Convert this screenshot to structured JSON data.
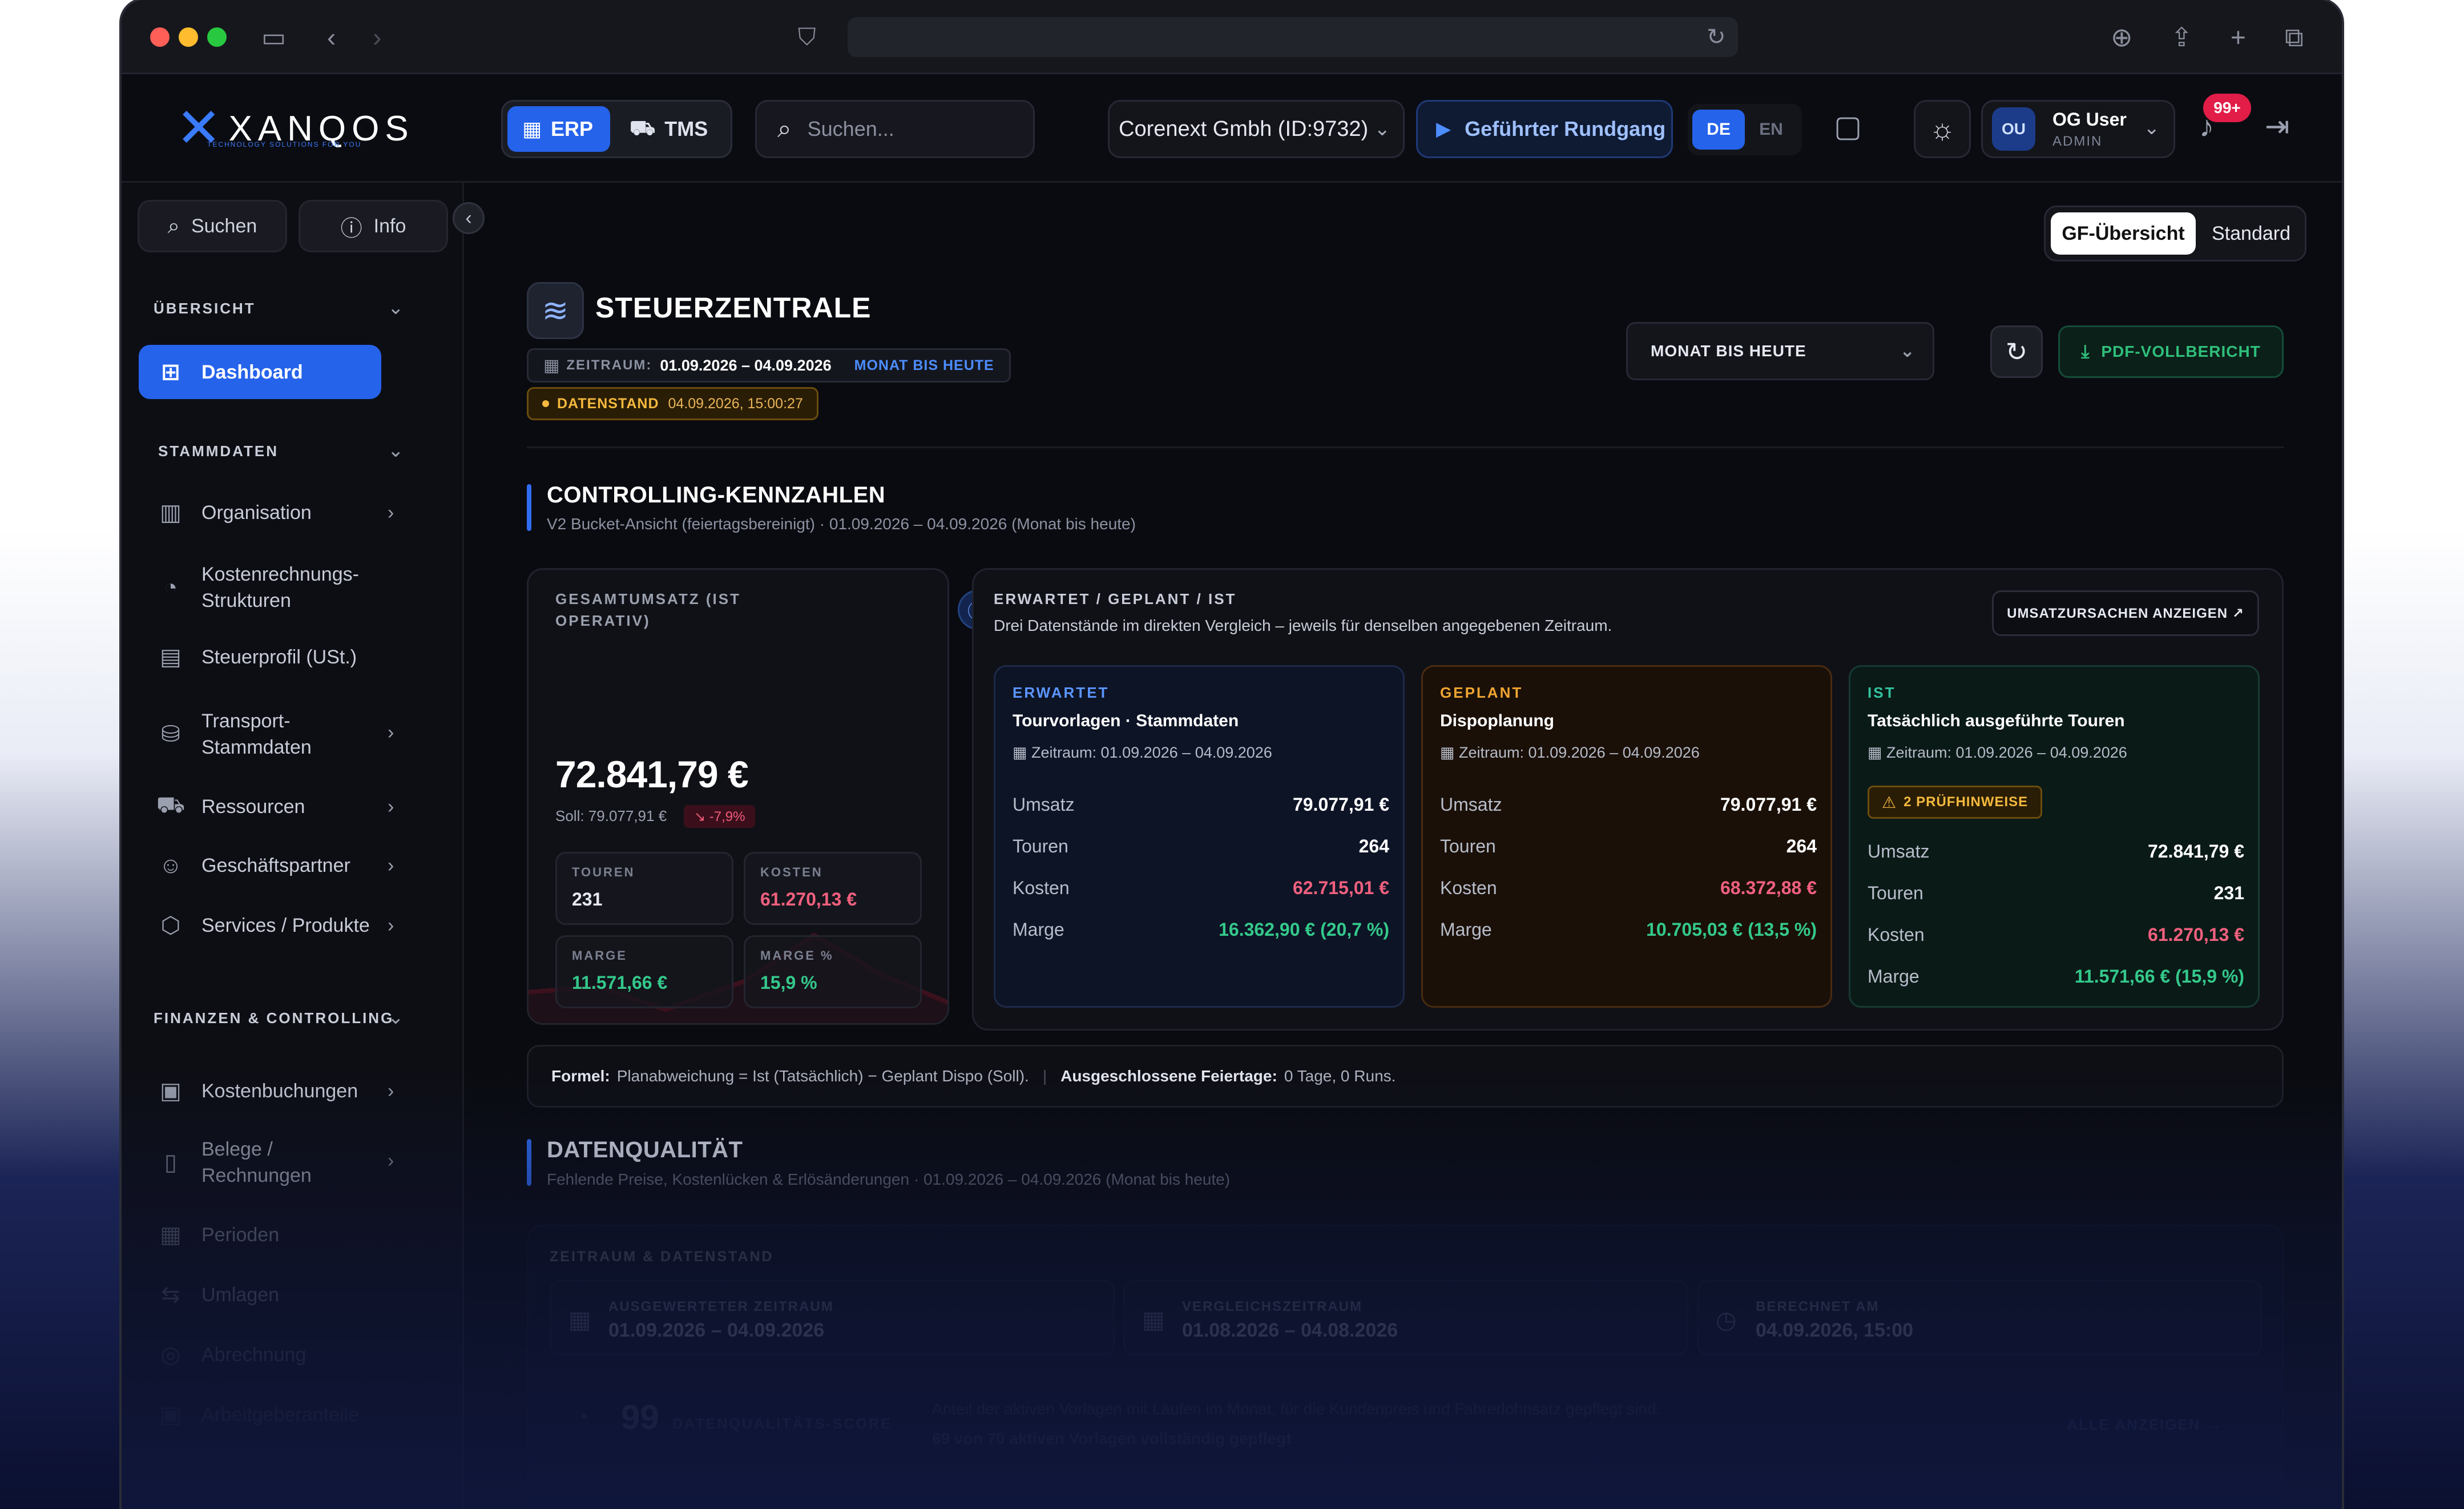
{
  "header": {
    "logo_text": "XANQOS",
    "logo_sub": "TECHNOLOGY SOLUTIONS FOR YOU",
    "systems": [
      {
        "label": "ERP",
        "active": true
      },
      {
        "label": "TMS",
        "active": false
      }
    ],
    "search_placeholder": "Suchen...",
    "company": "Corenext Gmbh (ID:9732)",
    "guided_tour": "Geführter Rundgang",
    "languages": [
      {
        "label": "DE",
        "active": true
      },
      {
        "label": "EN",
        "active": false
      }
    ],
    "user": {
      "initials": "OU",
      "name": "OG User",
      "role": "ADMIN"
    },
    "notifications": "99+"
  },
  "sidebar": {
    "search_label": "Suchen",
    "info_label": "Info",
    "sections": [
      {
        "title": "ÜBERSICHT"
      },
      {
        "title": "STAMMDATEN"
      },
      {
        "title": "FINANZEN & CONTROLLING"
      }
    ],
    "items": {
      "dashboard": "Dashboard",
      "organisation": "Organisation",
      "kostenrechnung": "Kostenrechnungs-\nStrukturen",
      "steuerprofil": "Steuerprofil (USt.)",
      "transport": "Transport-\nStammdaten",
      "ressourcen": "Ressourcen",
      "geschaeftspartner": "Geschäftspartner",
      "services": "Services / Produkte",
      "kostenbuchungen": "Kostenbuchungen",
      "belege": "Belege /\nRechnungen",
      "perioden": "Perioden",
      "umlagen": "Umlagen",
      "abrechnung": "Abrechnung",
      "arbeitgeber": "Arbeitgeberanteile"
    }
  },
  "view_toggle": [
    {
      "label": "GF-Übersicht",
      "active": true
    },
    {
      "label": "Standard",
      "active": false
    }
  ],
  "page": {
    "title": "STEUERZENTRALE",
    "zeitraum_key": "ZEITRAUM:",
    "zeitraum_value": "01.09.2026 – 04.09.2026",
    "zeitraum_tag": "MONAT BIS HEUTE",
    "datenstand_key": "DATENSTAND",
    "datenstand_value": "04.09.2026, 15:00:27",
    "range_select": "MONAT BIS HEUTE",
    "pdf_button": "PDF-VOLLBERICHT"
  },
  "controlling": {
    "title": "CONTROLLING-KENNZAHLEN",
    "subtitle": "V2 Bucket-Ansicht (feiertagsbereinigt) · 01.09.2026 – 04.09.2026 (Monat bis heute)",
    "gesamtumsatz_label": "GESAMTUMSATZ (IST OPERATIV)",
    "gesamtumsatz_value": "72.841,79 €",
    "soll": "Soll: 79.077,91 €",
    "delta": "↘ -7,9%",
    "minis": [
      {
        "key": "TOUREN",
        "value": "231",
        "tone": "white"
      },
      {
        "key": "KOSTEN",
        "value": "61.270,13 €",
        "tone": "red"
      },
      {
        "key": "MARGE",
        "value": "11.571,66 €",
        "tone": "green"
      },
      {
        "key": "MARGE %",
        "value": "15,9 %",
        "tone": "green"
      }
    ],
    "compare_label": "ERWARTET / GEPLANT / IST",
    "compare_desc": "Drei Datenstände im direkten Vergleich – jeweils für denselben angegebenen Zeitraum.",
    "reason_button": "UMSATZURSACHEN ANZEIGEN ↗",
    "columns": [
      {
        "title": "ERWARTET",
        "subtitle": "Tourvorlagen · Stammdaten",
        "period": "Zeitraum: 01.09.2026 – 04.09.2026",
        "rows": [
          {
            "k": "Umsatz",
            "v": "79.077,91 €"
          },
          {
            "k": "Touren",
            "v": "264"
          },
          {
            "k": "Kosten",
            "v": "62.715,01 €"
          },
          {
            "k": "Marge",
            "v": "16.362,90 € (20,7 %)"
          }
        ]
      },
      {
        "title": "GEPLANT",
        "subtitle": "Dispoplanung",
        "period": "Zeitraum: 01.09.2026 – 04.09.2026",
        "rows": [
          {
            "k": "Umsatz",
            "v": "79.077,91 €"
          },
          {
            "k": "Touren",
            "v": "264"
          },
          {
            "k": "Kosten",
            "v": "68.372,88 €"
          },
          {
            "k": "Marge",
            "v": "10.705,03 € (13,5 %)"
          }
        ]
      },
      {
        "title": "IST",
        "subtitle": "Tatsächlich ausgeführte Touren",
        "period": "Zeitraum: 01.09.2026 – 04.09.2026",
        "warning": "2 PRÜFHINWEISE",
        "rows": [
          {
            "k": "Umsatz",
            "v": "72.841,79 €"
          },
          {
            "k": "Touren",
            "v": "231"
          },
          {
            "k": "Kosten",
            "v": "61.270,13 €"
          },
          {
            "k": "Marge",
            "v": "11.571,66 € (15,9 %)"
          }
        ]
      }
    ],
    "formula_key": "Formel:",
    "formula_value": "Planabweichung = Ist (Tatsächlich) − Geplant Dispo (Soll).",
    "holidays_key": "Ausgeschlossene Feiertage:",
    "holidays_value": "0 Tage, 0 Runs."
  },
  "quality": {
    "title": "DATENQUALITÄT",
    "subtitle": "Fehlende Preise, Kostenlücken & Erlösänderungen · 01.09.2026 – 04.09.2026 (Monat bis heute)",
    "section_label": "ZEITRAUM & DATENSTAND",
    "boxes": [
      {
        "key": "AUSGEWERTETER ZEITRAUM",
        "value": "01.09.2026 – 04.09.2026"
      },
      {
        "key": "VERGLEICHSZEITRAUM",
        "value": "01.08.2026 – 04.08.2026"
      },
      {
        "key": "BERECHNET AM",
        "value": "04.09.2026, 15:00"
      }
    ],
    "score": "99",
    "score_label": "DATENQUALITÄTS-SCORE",
    "score_desc": "Anteil der aktiven Vorlagen mit Läufen im Monat, für die Kundenpreis und Fahrerlohnsatz gepflegt sind.",
    "score_desc2": "69 von 70 aktiven Vorlagen vollständig gepflegt",
    "show_all": "ALLE ANZEIGEN →"
  }
}
